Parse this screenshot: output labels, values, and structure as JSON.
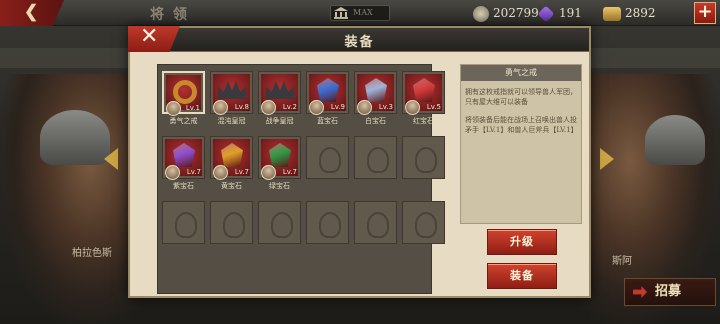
{
  "topbar": {
    "back_icon": "back-arrow-icon",
    "title": "将 领",
    "max_label": "MAX",
    "resources": {
      "coins": "202799",
      "gems": "191",
      "gold": "2892"
    },
    "plus_label": "+"
  },
  "background": {
    "left_hero_name": "柏拉色斯",
    "right_hero_name": "斯阿",
    "recruit_label": "招募"
  },
  "modal": {
    "title": "装备",
    "close_label": "✕",
    "items": [
      {
        "name": "勇气之戒",
        "level": "Lv.1",
        "kind": "ring",
        "selected": true
      },
      {
        "name": "混沌皇冠",
        "level": "Lv.8",
        "kind": "crown"
      },
      {
        "name": "战争皇冠",
        "level": "Lv.2",
        "kind": "crown"
      },
      {
        "name": "蓝宝石",
        "level": "Lv.9",
        "kind": "gem",
        "color": "#3b6fd6"
      },
      {
        "name": "白宝石",
        "level": "Lv.3",
        "kind": "gem",
        "color": "#9fb4d8"
      },
      {
        "name": "红宝石",
        "level": "Lv.5",
        "kind": "gem",
        "color": "#d63b3b"
      },
      {
        "name": "紫宝石",
        "level": "Lv.7",
        "kind": "gem",
        "color": "#8e4fd0"
      },
      {
        "name": "黄宝石",
        "level": "Lv.7",
        "kind": "gem",
        "color": "#e0a028"
      },
      {
        "name": "绿宝石",
        "level": "Lv.7",
        "kind": "gem",
        "color": "#2f9a47"
      }
    ],
    "total_slots": 18,
    "detail": {
      "title": "勇气之戒",
      "paragraph1": "拥有这枚戒指就可以领导兽人军团，只有屋大维可以装备",
      "paragraph2": "将领装备后能在战场上召唤出兽人投矛手【LV.1】和兽人巨斧兵【LV.1】"
    },
    "upgrade_label": "升级",
    "equip_label": "装备"
  }
}
